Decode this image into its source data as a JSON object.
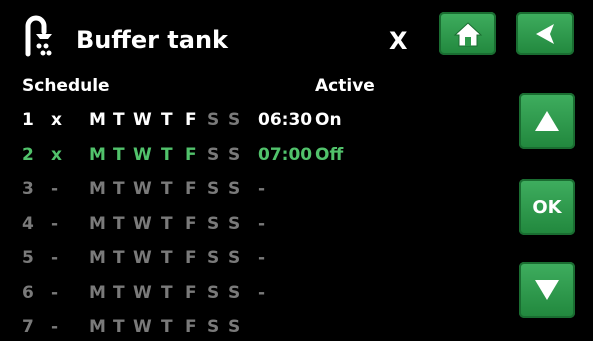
{
  "header": {
    "title": "Buffer tank",
    "close_label": "X"
  },
  "buttons": {
    "ok_label": "OK"
  },
  "columns": {
    "schedule": "Schedule",
    "active": "Active"
  },
  "rows": [
    {
      "num": "1",
      "flag": "x",
      "days": [
        "M",
        "T",
        "W",
        "T",
        "F",
        "S",
        "S"
      ],
      "time": "06:30",
      "active": "On",
      "state": "white",
      "active_days": [
        true,
        true,
        true,
        true,
        true,
        false,
        false
      ]
    },
    {
      "num": "2",
      "flag": "x",
      "days": [
        "M",
        "T",
        "W",
        "T",
        "F",
        "S",
        "S"
      ],
      "time": "07:00",
      "active": "Off",
      "state": "green",
      "active_days": [
        true,
        true,
        true,
        true,
        true,
        false,
        false
      ]
    },
    {
      "num": "3",
      "flag": "-",
      "days": [
        "M",
        "T",
        "W",
        "T",
        "F",
        "S",
        "S"
      ],
      "time": "-",
      "active": "",
      "state": "grey",
      "active_days": [
        false,
        false,
        false,
        false,
        false,
        false,
        false
      ]
    },
    {
      "num": "4",
      "flag": "-",
      "days": [
        "M",
        "T",
        "W",
        "T",
        "F",
        "S",
        "S"
      ],
      "time": "-",
      "active": "",
      "state": "grey",
      "active_days": [
        false,
        false,
        false,
        false,
        false,
        false,
        false
      ]
    },
    {
      "num": "5",
      "flag": "-",
      "days": [
        "M",
        "T",
        "W",
        "T",
        "F",
        "S",
        "S"
      ],
      "time": "-",
      "active": "",
      "state": "grey",
      "active_days": [
        false,
        false,
        false,
        false,
        false,
        false,
        false
      ]
    },
    {
      "num": "6",
      "flag": "-",
      "days": [
        "M",
        "T",
        "W",
        "T",
        "F",
        "S",
        "S"
      ],
      "time": "-",
      "active": "",
      "state": "grey",
      "active_days": [
        false,
        false,
        false,
        false,
        false,
        false,
        false
      ]
    },
    {
      "num": "7",
      "flag": "-",
      "days": [
        "M",
        "T",
        "W",
        "T",
        "F",
        "S",
        "S"
      ],
      "time": "",
      "active": "",
      "state": "grey",
      "active_days": [
        false,
        false,
        false,
        false,
        false,
        false,
        false
      ]
    }
  ],
  "colors": {
    "accent_green": "#51c26b",
    "button_green": "#2e9a4b",
    "inactive_grey": "#7a7a7a"
  },
  "icons": {
    "header": "shower-faucet-icon",
    "home": "home-icon",
    "back": "back-arrow-icon",
    "up": "up-arrow-icon",
    "down": "down-arrow-icon"
  }
}
